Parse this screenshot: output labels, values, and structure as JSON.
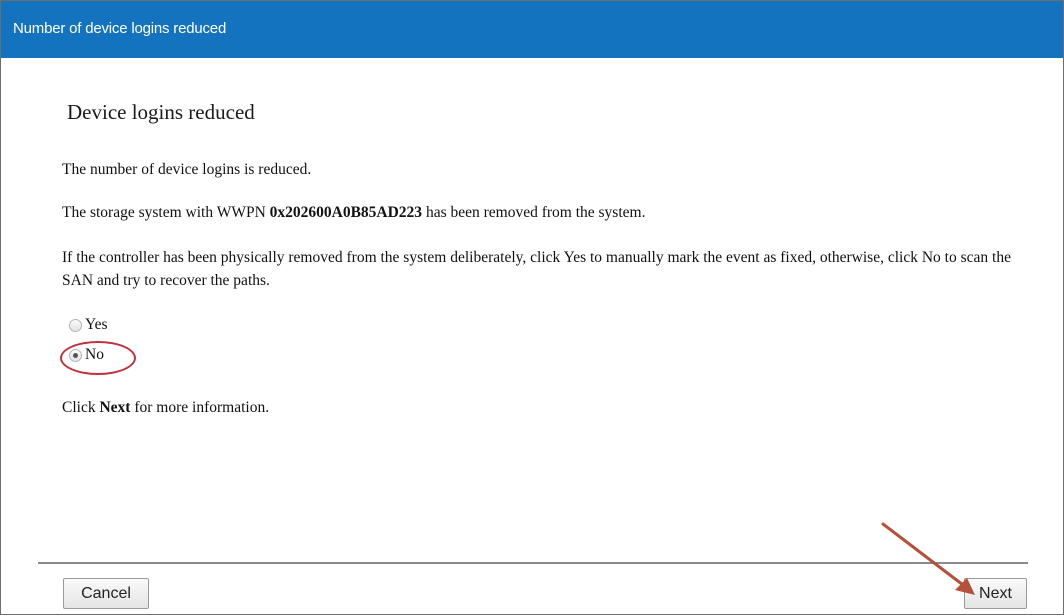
{
  "window": {
    "title": "Number of device logins reduced"
  },
  "content": {
    "heading": "Device logins reduced",
    "line1": "The number of device logins is reduced.",
    "line2_prefix": "The storage system with WWPN ",
    "wwpn": "0x202600A0B85AD223",
    "line2_suffix": " has been removed from the system.",
    "line3": "If the controller has been physically removed from the system deliberately, click Yes to manually mark the event as fixed, otherwise, click No to scan the SAN and try to recover the paths.",
    "line4_prefix": "Click ",
    "line4_bold": "Next",
    "line4_suffix": " for more information."
  },
  "options": {
    "yes_label": "Yes",
    "no_label": "No",
    "selected": "No"
  },
  "footer": {
    "cancel_label": "Cancel",
    "next_label": "Next"
  },
  "colors": {
    "titlebar": "#1473bf",
    "annotation": "#c0303a",
    "arrow": "#b5503a"
  }
}
